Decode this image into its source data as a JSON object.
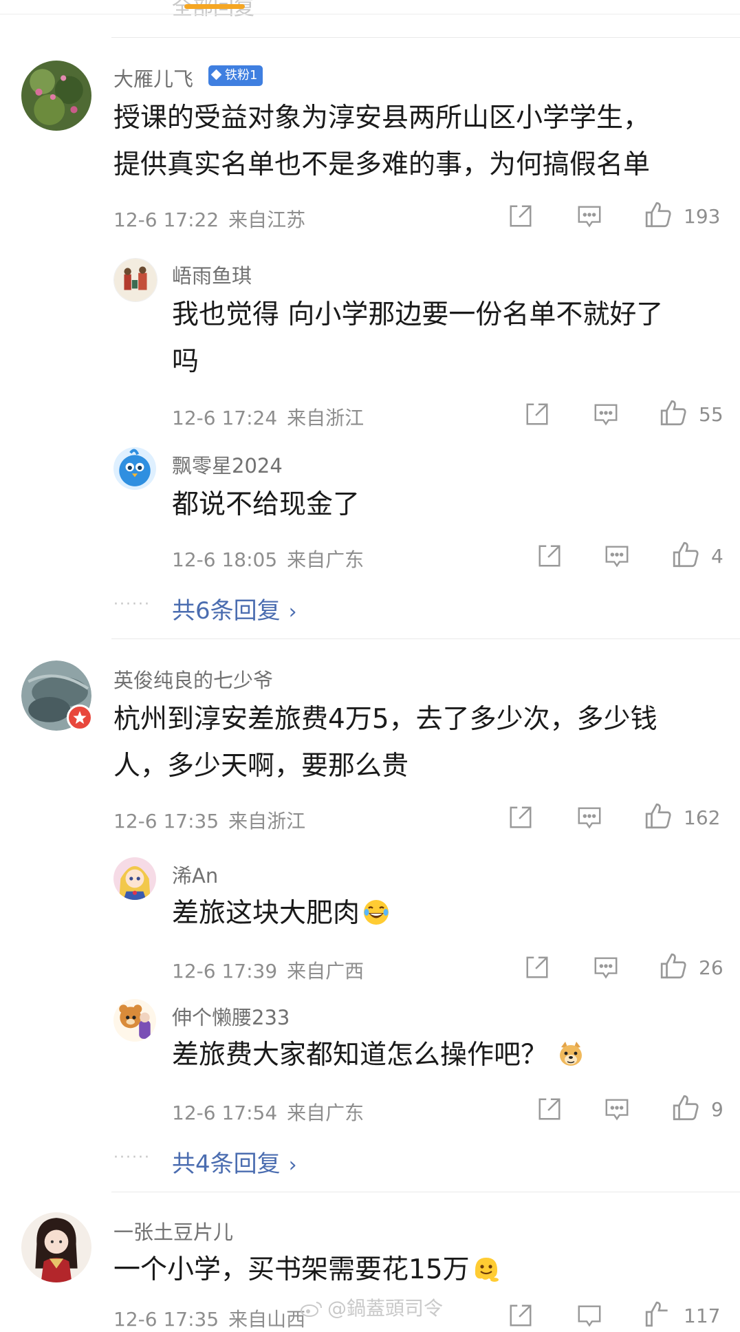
{
  "top": {
    "partial_text": "全部回复"
  },
  "comments": [
    {
      "user": "大雁儿飞",
      "badge": "铁粉1",
      "lines": [
        "授课的受益对象为淳安县两所山区小学学生，",
        "提供真实名单也不是多难的事，为何搞假名单"
      ],
      "time": "12-6 17:22",
      "location": "来自江苏",
      "likes": "193",
      "replies": [
        {
          "user": "峿雨鱼琪",
          "lines": [
            "我也觉得 向小学那边要一份名单不就好了",
            "吗"
          ],
          "time": "12-6 17:24",
          "location": "来自浙江",
          "likes": "55"
        },
        {
          "user": "飘零星2024",
          "lines": [
            "都说不给现金了"
          ],
          "time": "12-6 18:05",
          "location": "来自广东",
          "likes": "4"
        }
      ],
      "more_dots": "······",
      "more_replies": "共6条回复"
    },
    {
      "user": "英俊纯良的七少爷",
      "lines": [
        "杭州到淳安差旅费4万5，去了多少次，多少钱",
        "人，多少天啊，要那么贵"
      ],
      "time": "12-6 17:35",
      "location": "来自浙江",
      "likes": "162",
      "replies": [
        {
          "user": "浠An",
          "lines": [
            "差旅这块大肥肉"
          ],
          "time": "12-6 17:39",
          "location": "来自广西",
          "likes": "26",
          "emoji": "laughing-tears-emoji"
        },
        {
          "user": "伸个懒腰233",
          "lines": [
            "差旅费大家都知道怎么操作吧？"
          ],
          "time": "12-6 17:54",
          "location": "来自广东",
          "likes": "9",
          "emoji": "doge-emoji"
        }
      ],
      "more_dots": "······",
      "more_replies": "共4条回复"
    },
    {
      "user": "一张土豆片儿",
      "lines": [
        "一个小学，买书架需要花15万"
      ],
      "time": "12-6 17:35",
      "location": "来自山西",
      "likes": "117",
      "emoji": "melting-face-emoji"
    }
  ],
  "watermark": "@鍋蓋頭司令",
  "colors": {
    "link": "#4b6db0",
    "badge": "#3f7fe0",
    "meta": "#8e8e8e",
    "accent": "#f5a623"
  }
}
